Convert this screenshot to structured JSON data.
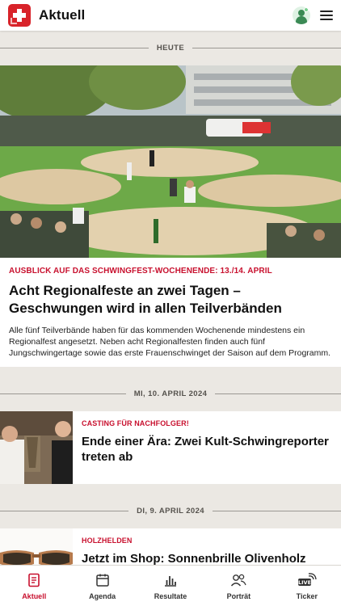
{
  "header": {
    "title": "Aktuell",
    "icons": {
      "logo": "swiss-cross-logo",
      "avatar": "user-avatar-icon",
      "menu": "hamburger-menu-icon"
    }
  },
  "sections": [
    {
      "date_label": "HEUTE"
    },
    {
      "date_label": "MI, 10. APRIL 2024"
    },
    {
      "date_label": "DI, 9. APRIL 2024"
    }
  ],
  "featured": {
    "kicker": "AUSBLICK AUF DAS SCHWINGFEST-WOCHENENDE: 13./14. APRIL",
    "headline": "Acht Regionalfeste an zwei Tagen – Geschwungen wird in allen Teilverbänden",
    "teaser": "Alle fünf Teilverbände haben für das kommenden Wochenende mindestens ein Regionalfest angesetzt. Neben acht Regionalfesten finden auch fünf Jungschwingertage sowie das erste Frauenschwinget der Saison auf dem Programm."
  },
  "articles": [
    {
      "kicker": "CASTING FÜR NACHFOLGER!",
      "title": "Ende einer Ära: Zwei Kult-Schwingreporter treten ab"
    },
    {
      "kicker": "HOLZHELDEN",
      "title": "Jetzt im Shop: Sonnenbrille Olivenholz"
    }
  ],
  "tabs": [
    {
      "label": "Aktuell",
      "icon": "news-icon",
      "active": true
    },
    {
      "label": "Agenda",
      "icon": "calendar-icon",
      "active": false
    },
    {
      "label": "Resultate",
      "icon": "bar-chart-icon",
      "active": false
    },
    {
      "label": "Porträt",
      "icon": "people-icon",
      "active": false
    },
    {
      "label": "Ticker",
      "icon": "live-ticker-icon",
      "active": false
    }
  ],
  "colors": {
    "accent": "#c8102e",
    "logo_red": "#d8232a",
    "background": "#ebe8e3"
  }
}
